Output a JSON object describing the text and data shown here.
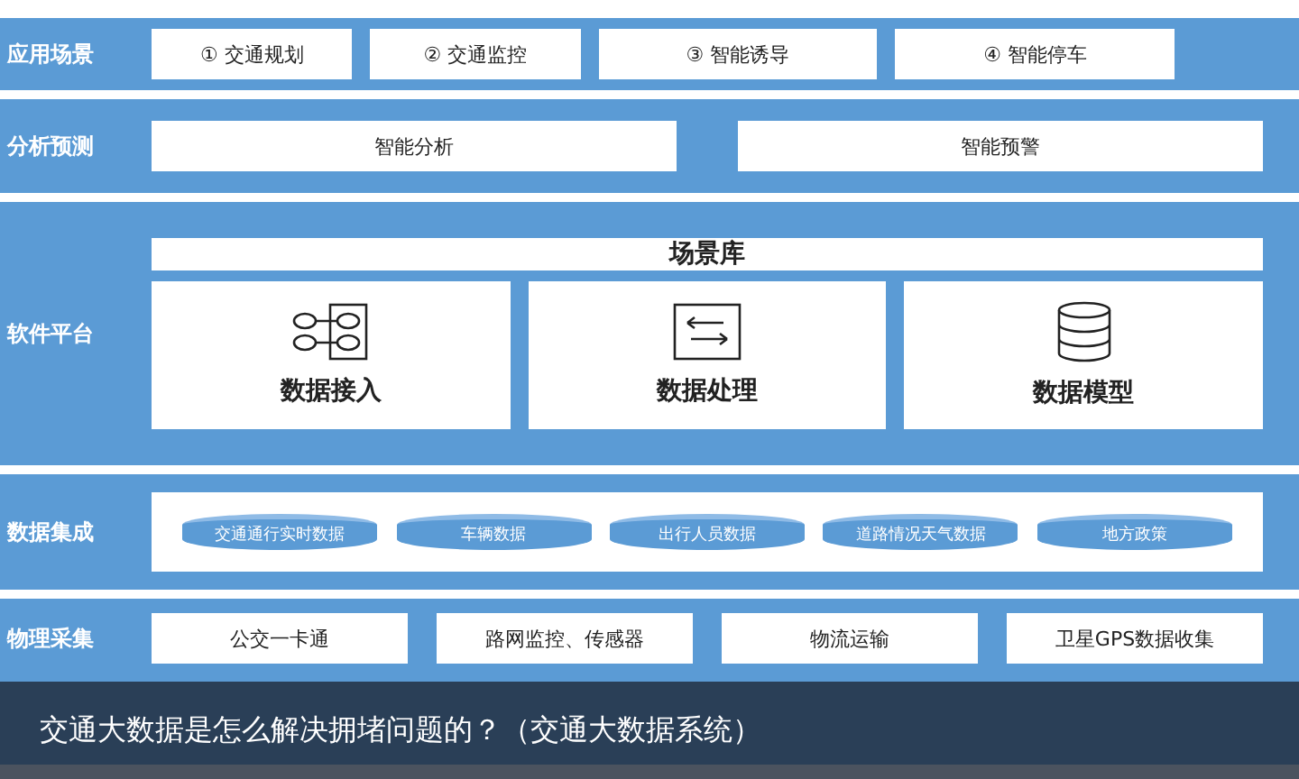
{
  "layers": [
    {
      "kind": "buttons",
      "label": "应用场景",
      "items": [
        "① 交通规划",
        "② 交通监控",
        "③ 智能诱导",
        "④ 智能停车"
      ]
    },
    {
      "kind": "wide",
      "label": "分析预测",
      "items": [
        "智能分析",
        "智能预警"
      ]
    },
    {
      "kind": "platform",
      "label": "软件平台",
      "header": "场景库",
      "cards": [
        {
          "title": "数据接入"
        },
        {
          "title": "数据处理"
        },
        {
          "title": "数据模型"
        }
      ]
    },
    {
      "kind": "cylinders",
      "label": "数据集成",
      "items": [
        "交通通行实时数据",
        "车辆数据",
        "出行人员数据",
        "道路情况天气数据",
        "地方政策"
      ]
    },
    {
      "kind": "collect",
      "label": "物理采集",
      "items": [
        "公交一卡通",
        "路网监控、传感器",
        "物流运输",
        "卫星GPS数据收集"
      ]
    }
  ],
  "caption": "交通大数据是怎么解决拥堵问题的？（交通大数据系统）"
}
